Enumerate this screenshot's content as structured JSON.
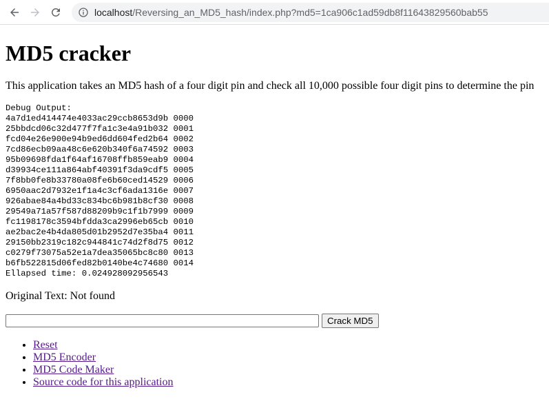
{
  "browser": {
    "url_host": "localhost",
    "url_path": "/Reversing_an_MD5_hash/index.php?md5=1ca906c1ad59db8f11643829560bab55"
  },
  "page": {
    "title": "MD5 cracker",
    "description": "This application takes an MD5 hash of a four digit pin and check all 10,000 possible four digit pins to determine the pin",
    "debug_output": "Debug Output:\n4a7d1ed414474e4033ac29ccb8653d9b 0000\n25bbdcd06c32d477f7fa1c3e4a91b032 0001\nfcd04e26e900e94b9ed6dd604fed2b64 0002\n7cd86ecb09aa48c6e620b340f6a74592 0003\n95b09698fda1f64af16708ffb859eab9 0004\nd39934ce111a864abf40391f3da9cdf5 0005\n7f8bb0fe8b33780a08fe6b60ced14529 0006\n6950aac2d7932e1f1a4c3cf6ada1316e 0007\n926abae84a4bd33c834bc6b981b8cf30 0008\n29549a71a57f587d88209b9c1f1b7999 0009\nfc1198178c3594bfdda3ca2996eb65cb 0010\nae2bac2e4b4da805d01b2952d7e35ba4 0011\n29150bb2319c182c944841c74d2f8d75 0012\nc0279f73075a52e1a7dea35065bc8c80 0013\nb6fb522815d06fed82b0140be4c74680 0014\nEllapsed time: 0.024928092956543",
    "original_text": "Original Text: Not found",
    "input_value": "",
    "button_label": "Crack MD5",
    "links": [
      "Reset",
      "MD5 Encoder",
      "MD5 Code Maker",
      "Source code for this application"
    ]
  },
  "icons": {
    "back": "arrow-left-icon",
    "forward": "arrow-right-icon",
    "reload": "reload-icon",
    "info": "info-icon"
  },
  "colors": {
    "link_visited": "#551a8b",
    "omnibox_bg": "#f1f3f4",
    "url_path": "#5f6368"
  }
}
